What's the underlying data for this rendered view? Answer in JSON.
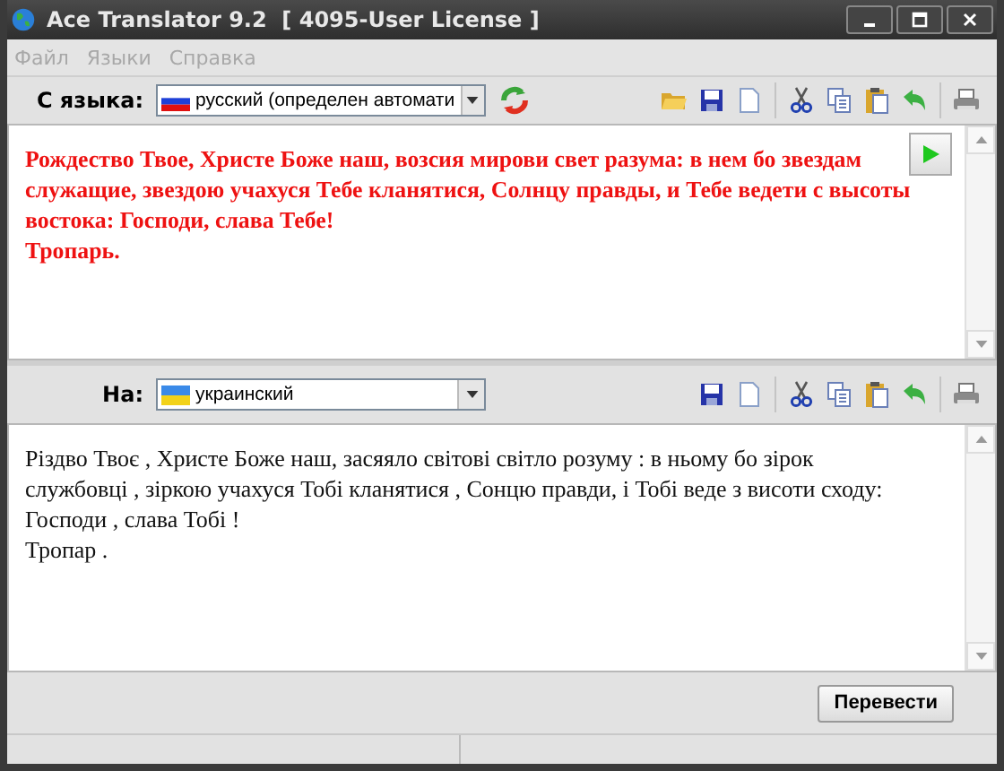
{
  "window": {
    "title": "Ace Translator 9.2  [ 4095-User License ]"
  },
  "menu": [
    {
      "label": "Файл",
      "disabled": true
    },
    {
      "label": "Языки",
      "disabled": true
    },
    {
      "label": "Справка",
      "disabled": true
    }
  ],
  "source": {
    "label": "С языка:",
    "language": "русский (определен автомати",
    "kind": "russian",
    "paragraphs": [
      "Рождество Твое, Христе Боже наш, возсия мирови свет разума: в нем бо звездам служащие, звездою учахуся Тебе кланятися, Солнцу правды, и Тебе ведети с высоты востока: Господи, слава Тебе!",
      "Тропарь."
    ]
  },
  "target": {
    "label": "На:",
    "language": "украинский",
    "kind": "ukrainian",
    "paragraphs": [
      "Різдво Твоє , Христе Боже наш, засяяло світові світло розуму : в ньому бо зірок службовці , зіркою учахуся Тобі кланятися , Сонцю правди, і Тобі веде з висоти сходу: Господи , слава Тобі !",
      "Тропар ."
    ]
  },
  "translate_button": "Перевести"
}
